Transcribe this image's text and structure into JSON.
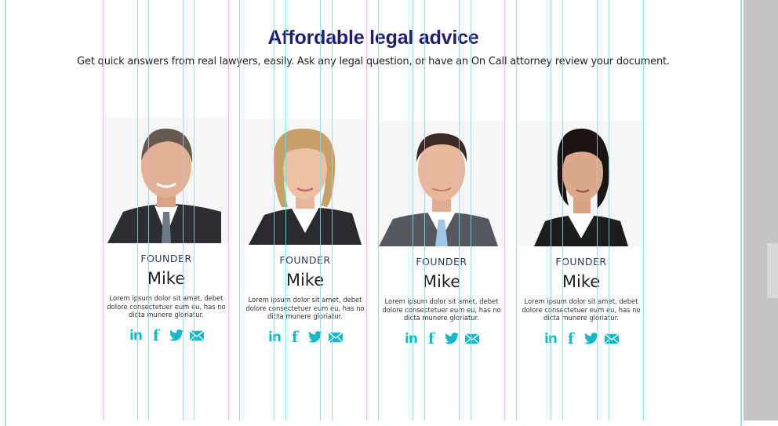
{
  "header": {
    "title": "Affordable legal advice",
    "subtitle": "Get quick answers from real lawyers, easily. Ask any legal question, or have an On Call attorney review your document."
  },
  "team": [
    {
      "role": "FOUNDER",
      "name": "Mike",
      "bio": "Lorem ipsum dolor sit amet, debet dolore consectetuer eum eu, has no dicta munere gloriatur.",
      "photo": "man-portrait-gray-hair"
    },
    {
      "role": "FOUNDER",
      "name": "Mike",
      "bio": "Lorem ipsum dolor sit amet, debet dolore consectetuer eum eu, has no dicta munere gloriatur.",
      "photo": "woman-portrait-blonde"
    },
    {
      "role": "FOUNDER",
      "name": "Mike",
      "bio": "Lorem ipsum dolor sit amet, debet dolore consectetuer eum eu, has no dicta munere gloriatur.",
      "photo": "man-portrait-young"
    },
    {
      "role": "FOUNDER",
      "name": "Mike",
      "bio": "Lorem ipsum dolor sit amet, debet dolore consectetuer eum eu, has no dicta munere gloriatur.",
      "photo": "woman-portrait-dark-hair"
    }
  ],
  "social_icons": [
    "linkedin-icon",
    "facebook-icon",
    "twitter-icon",
    "email-icon"
  ],
  "colors": {
    "title": "#1f1f6b",
    "accent": "#1ab8c6",
    "guide": "#7fdcea"
  }
}
